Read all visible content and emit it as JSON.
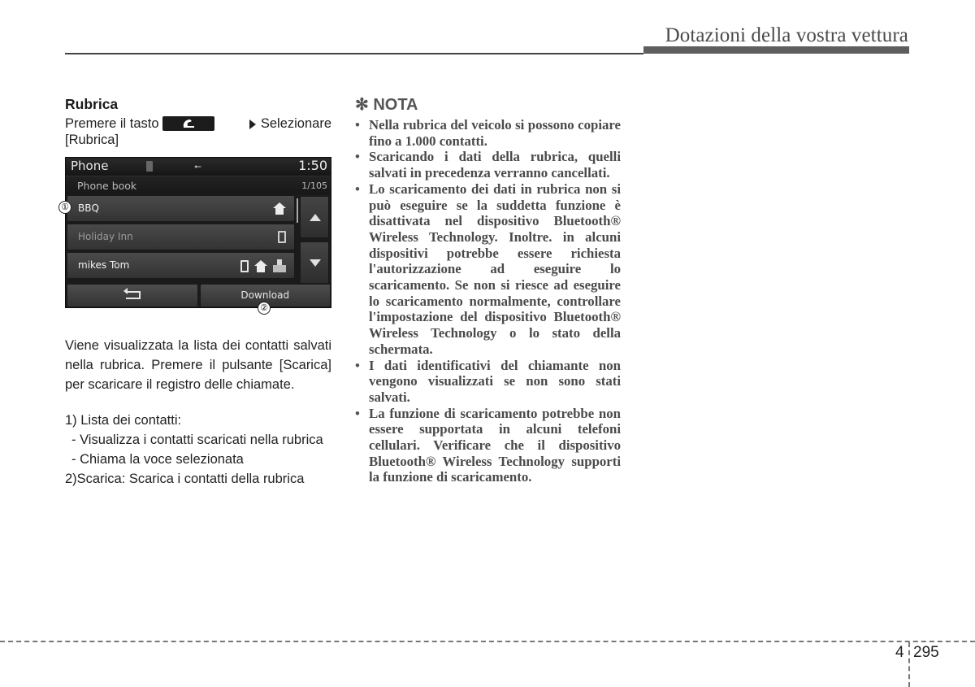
{
  "header": {
    "title": "Dotazioni della vostra vettura"
  },
  "section": {
    "title": "Rubrica",
    "instruction_before": "Premere il tasto",
    "instruction_key_icon": "phone-icon",
    "instruction_after": "Selezionare",
    "instruction_line2": "[Rubrica]"
  },
  "screen": {
    "status": {
      "app": "Phone",
      "bluetooth_icon": "bluetooth-icon",
      "usb_icon": "usb-icon",
      "usb_glyph": "⭠",
      "clock": "1:50"
    },
    "subheader": {
      "title": "Phone book",
      "counter": "1/105"
    },
    "contacts": [
      {
        "name": "BBQ",
        "icons": [
          "home"
        ],
        "dim": false
      },
      {
        "name": "Holiday Inn",
        "icons": [
          "mobile"
        ],
        "dim": true
      },
      {
        "name": "mikes Tom",
        "icons": [
          "mobile",
          "home",
          "office"
        ],
        "dim": false
      }
    ],
    "scroll_up_icon": "arrow-up-icon",
    "scroll_down_icon": "arrow-down-icon",
    "back_icon": "back-icon",
    "download_label": "Download",
    "callouts": [
      "①",
      "②"
    ]
  },
  "body": {
    "paragraph": "Viene visualizzata la lista dei contatti salvati nella rubrica. Premere il pulsante [Scarica] per scaricare il registro delle chiamate.",
    "items": [
      {
        "label": "1) Lista dei contatti:",
        "subitems": [
          "- Visualizza i contatti scaricati nella rubrica",
          "- Chiama la voce selezionata"
        ]
      },
      {
        "label": "2)Scarica: Scarica i contatti della rubrica",
        "subitems": []
      }
    ]
  },
  "note": {
    "title": "✻ NOTA",
    "bullets": [
      "Nella rubrica del veicolo si possono copiare fino a 1.000 contatti.",
      "Scaricando i dati della rubrica, quelli salvati in precedenza verranno cancellati.",
      "Lo scaricamento dei dati in rubrica non si può eseguire se la suddetta funzione è disattivata nel dispositivo Bluetooth® Wireless Technology. Inoltre. in alcuni dispositivi potrebbe essere richiesta l'autorizzazione ad eseguire lo scaricamento. Se non si riesce ad eseguire lo scaricamento normalmente, controllare l'impostazione del dispositivo Bluetooth® Wireless Technology o lo stato della schermata.",
      "I dati identificativi del chiamante non vengono visualizzati se non sono stati salvati.",
      "La funzione di scaricamento potrebbe non essere supportata in alcuni telefoni cellulari. Verificare che il dispositivo Bluetooth® Wireless Technology supporti la funzione di scaricamento."
    ]
  },
  "footer": {
    "chapter": "4",
    "page": "295"
  }
}
